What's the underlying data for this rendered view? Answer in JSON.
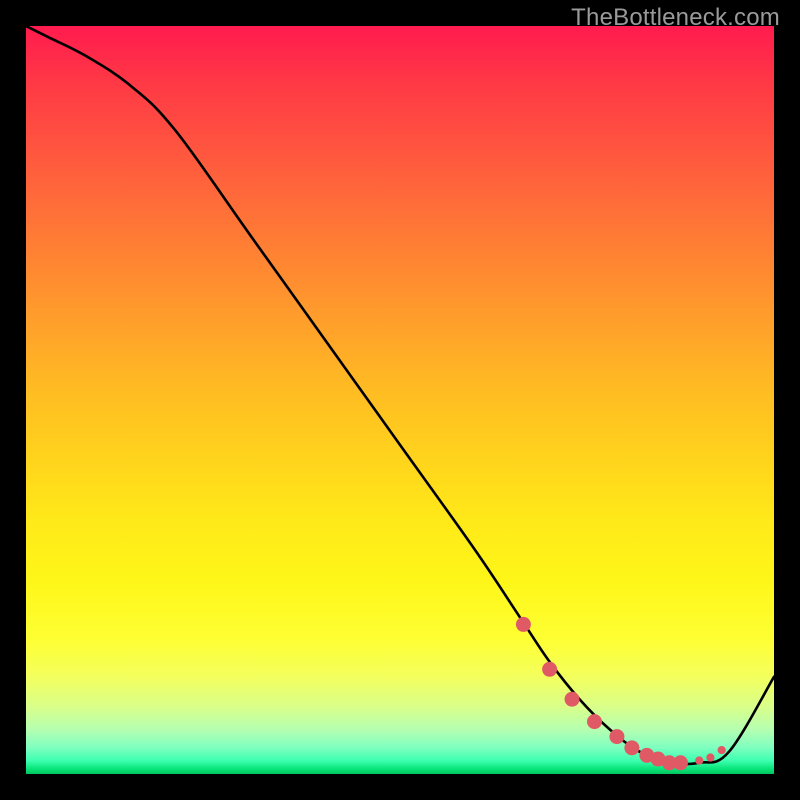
{
  "watermark": "TheBottleneck.com",
  "chart_data": {
    "type": "line",
    "title": "",
    "xlabel": "",
    "ylabel": "",
    "xlim": [
      0,
      100
    ],
    "ylim": [
      0,
      100
    ],
    "background_gradient": "red-yellow-green vertical heatmap",
    "series": [
      {
        "name": "curve",
        "color": "#000000",
        "x": [
          0,
          3,
          8,
          14,
          20,
          30,
          40,
          50,
          60,
          66,
          70,
          74,
          78,
          82,
          86,
          90,
          94,
          100
        ],
        "y": [
          100,
          98.5,
          96,
          92,
          86,
          72,
          58,
          44,
          30,
          21,
          15,
          10,
          6,
          3,
          1.5,
          1.5,
          3,
          13
        ]
      }
    ],
    "markers": {
      "name": "flat-region",
      "color": "#e05a66",
      "size_large": 6,
      "size_small": 4,
      "x": [
        66.5,
        70,
        73,
        76,
        79,
        81,
        83,
        84.5,
        86,
        87.5,
        90,
        91.5,
        93
      ],
      "y": [
        20,
        14,
        10,
        7,
        5,
        3.5,
        2.5,
        2,
        1.5,
        1.5,
        1.8,
        2.2,
        3.2
      ],
      "sizes": [
        "L",
        "L",
        "L",
        "L",
        "L",
        "L",
        "L",
        "L",
        "L",
        "L",
        "S",
        "S",
        "S"
      ]
    }
  }
}
